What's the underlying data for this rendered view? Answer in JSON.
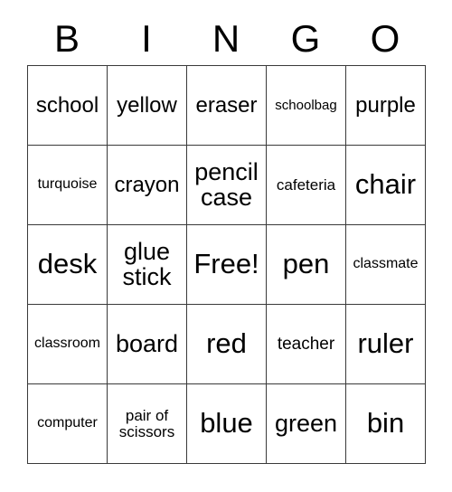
{
  "card": {
    "title_letters": [
      "B",
      "I",
      "N",
      "G",
      "O"
    ],
    "free_space_label": "Free!",
    "border_color": "#3a3a3a",
    "background_color": "#ffffff",
    "text_color": "#000000",
    "rows": [
      [
        {
          "text": "school",
          "size": "lg"
        },
        {
          "text": "yellow",
          "size": "lg"
        },
        {
          "text": "eraser",
          "size": "lg"
        },
        {
          "text": "schoolbag",
          "size": "xs"
        },
        {
          "text": "purple",
          "size": "lg"
        }
      ],
      [
        {
          "text": "turquoise",
          "size": "sm",
          "lines": 1
        },
        {
          "text": "crayon",
          "size": "lg"
        },
        {
          "text": "pencil\ncase",
          "size": "xl",
          "lines": 2
        },
        {
          "text": "cafeteria",
          "size": "smp"
        },
        {
          "text": "chair",
          "size": "xxl"
        }
      ],
      [
        {
          "text": "desk",
          "size": "xxl"
        },
        {
          "text": "glue\nstick",
          "size": "xl",
          "lines": 2
        },
        {
          "text": "Free!",
          "size": "xxl"
        },
        {
          "text": "pen",
          "size": "xxl"
        },
        {
          "text": "classmate",
          "size": "sm"
        }
      ],
      [
        {
          "text": "classroom",
          "size": "sm"
        },
        {
          "text": "board",
          "size": "xl"
        },
        {
          "text": "red",
          "size": "xxl"
        },
        {
          "text": "teacher",
          "size": "md"
        },
        {
          "text": "ruler",
          "size": "xxl"
        }
      ],
      [
        {
          "text": "computer",
          "size": "sm"
        },
        {
          "text": "pair of\nscissors",
          "size": "smp",
          "lines": 2
        },
        {
          "text": "blue",
          "size": "xxl"
        },
        {
          "text": "green",
          "size": "xl"
        },
        {
          "text": "bin",
          "size": "xxl"
        }
      ]
    ]
  }
}
